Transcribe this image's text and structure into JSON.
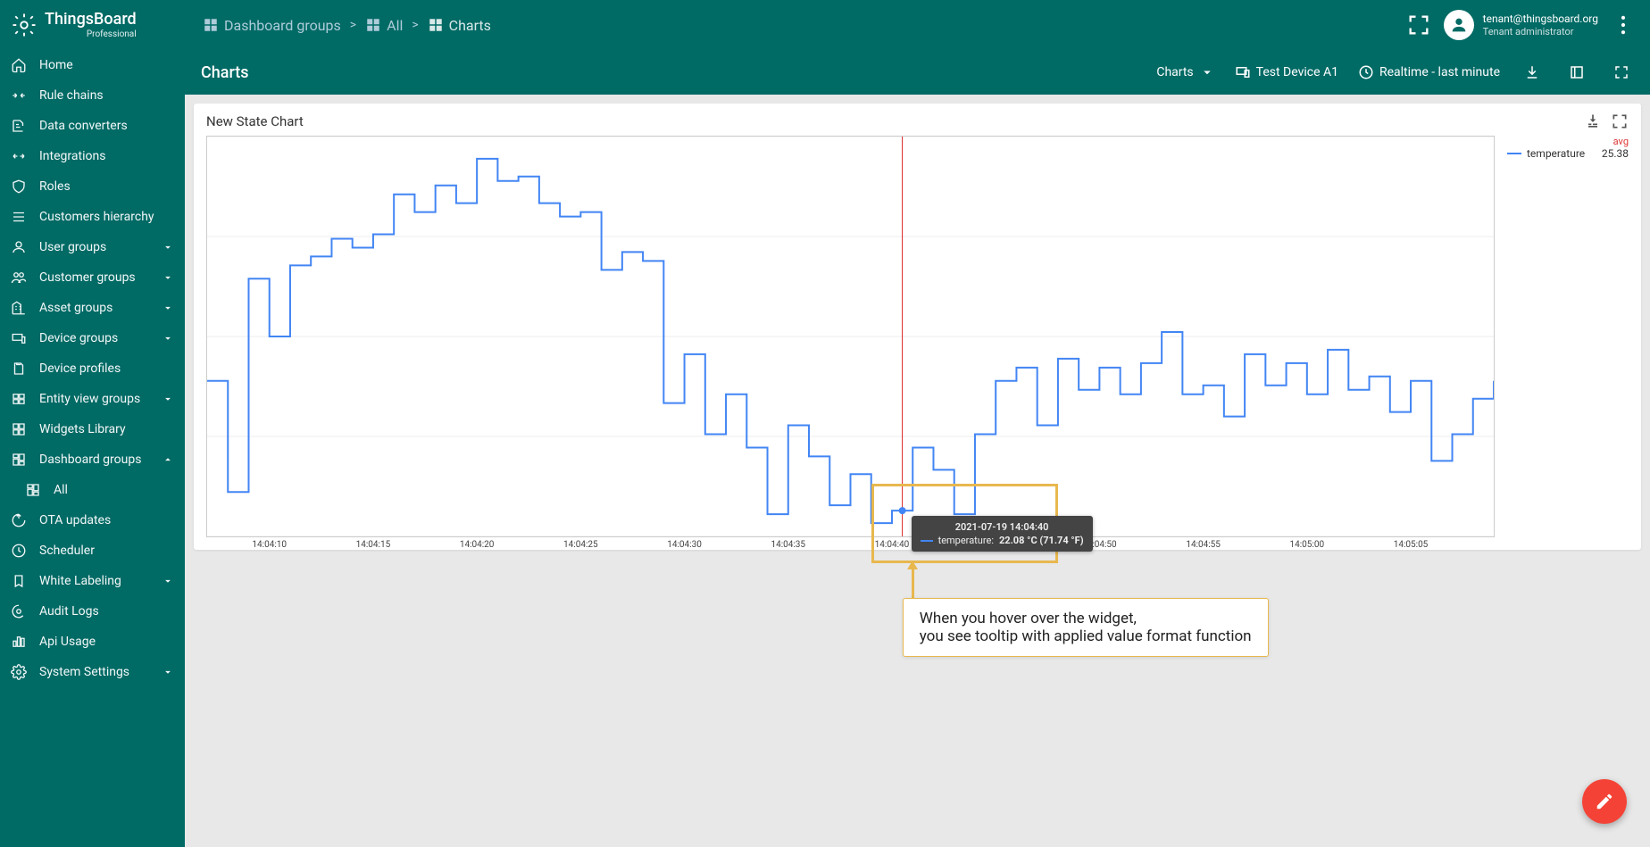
{
  "app": {
    "name": "ThingsBoard",
    "edition": "Professional"
  },
  "user": {
    "email": "tenant@thingsboard.org",
    "role": "Tenant administrator"
  },
  "breadcrumb": [
    {
      "label": "Dashboard groups"
    },
    {
      "label": "All"
    },
    {
      "label": "Charts"
    }
  ],
  "sidebar": {
    "items": [
      {
        "label": "Home",
        "icon": "home"
      },
      {
        "label": "Rule chains",
        "icon": "rules"
      },
      {
        "label": "Data converters",
        "icon": "convert"
      },
      {
        "label": "Integrations",
        "icon": "integrate"
      },
      {
        "label": "Roles",
        "icon": "shield"
      },
      {
        "label": "Customers hierarchy",
        "icon": "hierarchy"
      },
      {
        "label": "User groups",
        "icon": "user",
        "expand": true
      },
      {
        "label": "Customer groups",
        "icon": "people",
        "expand": true
      },
      {
        "label": "Asset groups",
        "icon": "domain",
        "expand": true
      },
      {
        "label": "Device groups",
        "icon": "devices",
        "expand": true
      },
      {
        "label": "Device profiles",
        "icon": "profile"
      },
      {
        "label": "Entity view groups",
        "icon": "entity",
        "expand": true
      },
      {
        "label": "Widgets Library",
        "icon": "widgets"
      },
      {
        "label": "Dashboard groups",
        "icon": "dashboard",
        "expand": true,
        "open": true
      },
      {
        "label": "All",
        "icon": "dashboard",
        "sub": true
      },
      {
        "label": "OTA updates",
        "icon": "ota"
      },
      {
        "label": "Scheduler",
        "icon": "clock"
      },
      {
        "label": "White Labeling",
        "icon": "label",
        "expand": true
      },
      {
        "label": "Audit Logs",
        "icon": "audit"
      },
      {
        "label": "Api Usage",
        "icon": "api"
      },
      {
        "label": "System Settings",
        "icon": "gear",
        "expand": true
      }
    ]
  },
  "dashboard": {
    "title": "Charts",
    "entitySelector": "Charts",
    "device": "Test Device A1",
    "timewindow": "Realtime - last minute"
  },
  "widget": {
    "title": "New State Chart",
    "legend": {
      "aggLabel": "avg",
      "series": "temperature",
      "aggValue": "25.38"
    },
    "tooltip": {
      "date": "2021-07-19 14:04:40",
      "series": "temperature",
      "value": "22.08 °C (71.74 °F)"
    }
  },
  "annotation": {
    "line1": "When you hover over the widget,",
    "line2": "you see tooltip with applied value format function"
  },
  "chart_data": {
    "type": "line",
    "step": "after",
    "title": "New State Chart",
    "xlabel": "",
    "ylabel": "",
    "x_ticks": [
      "14:04:10",
      "14:04:15",
      "14:04:20",
      "14:04:25",
      "14:04:30",
      "14:04:35",
      "14:04:40",
      "14:04:45",
      "14:04:50",
      "14:04:55",
      "14:05:00",
      "14:05:05"
    ],
    "x_range_seconds": [
      7,
      69
    ],
    "y_range_estimated": [
      21.5,
      30.5
    ],
    "series": [
      {
        "name": "temperature",
        "color": "#4285f4",
        "avg": 25.38,
        "points_t_seconds_value": [
          [
            7,
            25.0
          ],
          [
            8,
            22.5
          ],
          [
            9,
            27.3
          ],
          [
            10,
            26.0
          ],
          [
            11,
            27.6
          ],
          [
            12,
            27.8
          ],
          [
            13,
            28.2
          ],
          [
            14,
            28.0
          ],
          [
            15,
            28.3
          ],
          [
            16,
            29.2
          ],
          [
            17,
            28.8
          ],
          [
            18,
            29.4
          ],
          [
            19,
            29.0
          ],
          [
            20,
            30.0
          ],
          [
            21,
            29.5
          ],
          [
            22,
            29.6
          ],
          [
            23,
            29.0
          ],
          [
            24,
            28.7
          ],
          [
            25,
            28.8
          ],
          [
            26,
            27.5
          ],
          [
            27,
            27.9
          ],
          [
            28,
            27.7
          ],
          [
            29,
            24.5
          ],
          [
            30,
            25.6
          ],
          [
            31,
            23.8
          ],
          [
            32,
            24.7
          ],
          [
            33,
            23.5
          ],
          [
            34,
            22.0
          ],
          [
            35,
            24.0
          ],
          [
            36,
            23.3
          ],
          [
            37,
            22.2
          ],
          [
            38,
            22.9
          ],
          [
            39,
            21.8
          ],
          [
            40,
            22.08
          ],
          [
            41,
            23.5
          ],
          [
            42,
            23.0
          ],
          [
            43,
            22.0
          ],
          [
            44,
            23.8
          ],
          [
            45,
            25.0
          ],
          [
            46,
            25.3
          ],
          [
            47,
            24.0
          ],
          [
            48,
            25.5
          ],
          [
            49,
            24.8
          ],
          [
            50,
            25.3
          ],
          [
            51,
            24.7
          ],
          [
            52,
            25.4
          ],
          [
            53,
            26.1
          ],
          [
            54,
            24.7
          ],
          [
            55,
            24.9
          ],
          [
            56,
            24.2
          ],
          [
            57,
            25.6
          ],
          [
            58,
            24.9
          ],
          [
            59,
            25.4
          ],
          [
            60,
            24.7
          ],
          [
            61,
            25.7
          ],
          [
            62,
            24.8
          ],
          [
            63,
            25.1
          ],
          [
            64,
            24.3
          ],
          [
            65,
            25.0
          ],
          [
            66,
            23.2
          ],
          [
            67,
            23.8
          ],
          [
            68,
            24.6
          ],
          [
            69,
            25.0
          ]
        ]
      }
    ],
    "hover_cursor_at_t_seconds": 40.5
  }
}
